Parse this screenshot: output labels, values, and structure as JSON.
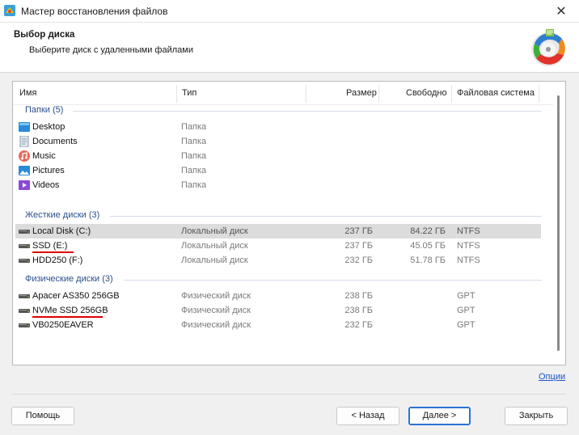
{
  "window": {
    "title": "Мастер восстановления файлов",
    "close_glyph": "✕"
  },
  "header": {
    "title": "Выбор диска",
    "subtitle": "Выберите диск с удаленными файлами"
  },
  "columns": {
    "name": "Имя",
    "type": "Тип",
    "size": "Размер",
    "free": "Свободно",
    "fs": "Файловая система"
  },
  "groups": [
    {
      "label": "Папки (5)",
      "items": [
        {
          "name": "Desktop",
          "type": "Папка",
          "icon": "desktop-folder-icon"
        },
        {
          "name": "Documents",
          "type": "Папка",
          "icon": "documents-folder-icon"
        },
        {
          "name": "Music",
          "type": "Папка",
          "icon": "music-folder-icon"
        },
        {
          "name": "Pictures",
          "type": "Папка",
          "icon": "pictures-folder-icon"
        },
        {
          "name": "Videos",
          "type": "Папка",
          "icon": "videos-folder-icon"
        }
      ]
    },
    {
      "label": "Жесткие диски (3)",
      "items": [
        {
          "name": "Local Disk (C:)",
          "type": "Локальный диск",
          "size": "237 ГБ",
          "free": "84.22 ГБ",
          "fs": "NTFS",
          "icon": "drive-icon",
          "selected": true
        },
        {
          "name": "SSD (E:)",
          "type": "Локальный диск",
          "size": "237 ГБ",
          "free": "45.05 ГБ",
          "fs": "NTFS",
          "icon": "drive-icon",
          "underlined": true
        },
        {
          "name": "HDD250 (F:)",
          "type": "Локальный диск",
          "size": "232 ГБ",
          "free": "51.78 ГБ",
          "fs": "NTFS",
          "icon": "drive-icon"
        }
      ]
    },
    {
      "label": "Физические диски (3)",
      "items": [
        {
          "name": "Apacer AS350 256GB",
          "type": "Физический диск",
          "size": "238 ГБ",
          "fs": "GPT",
          "icon": "drive-icon"
        },
        {
          "name": "NVMe SSD 256GB",
          "type": "Физический диск",
          "size": "238 ГБ",
          "fs": "GPT",
          "icon": "drive-icon",
          "underlined": true
        },
        {
          "name": "VB0250EAVER",
          "type": "Физический диск",
          "size": "232 ГБ",
          "fs": "GPT",
          "icon": "drive-icon"
        }
      ]
    }
  ],
  "options_link": "Опции",
  "buttons": {
    "help": "Помощь",
    "back": "< Назад",
    "next": "Далее >",
    "close": "Закрыть"
  },
  "colors": {
    "accent": "#2b72d6",
    "group_label": "#2a4f8c",
    "underline": "#e00000",
    "selected_row": "#dcdcdc"
  }
}
